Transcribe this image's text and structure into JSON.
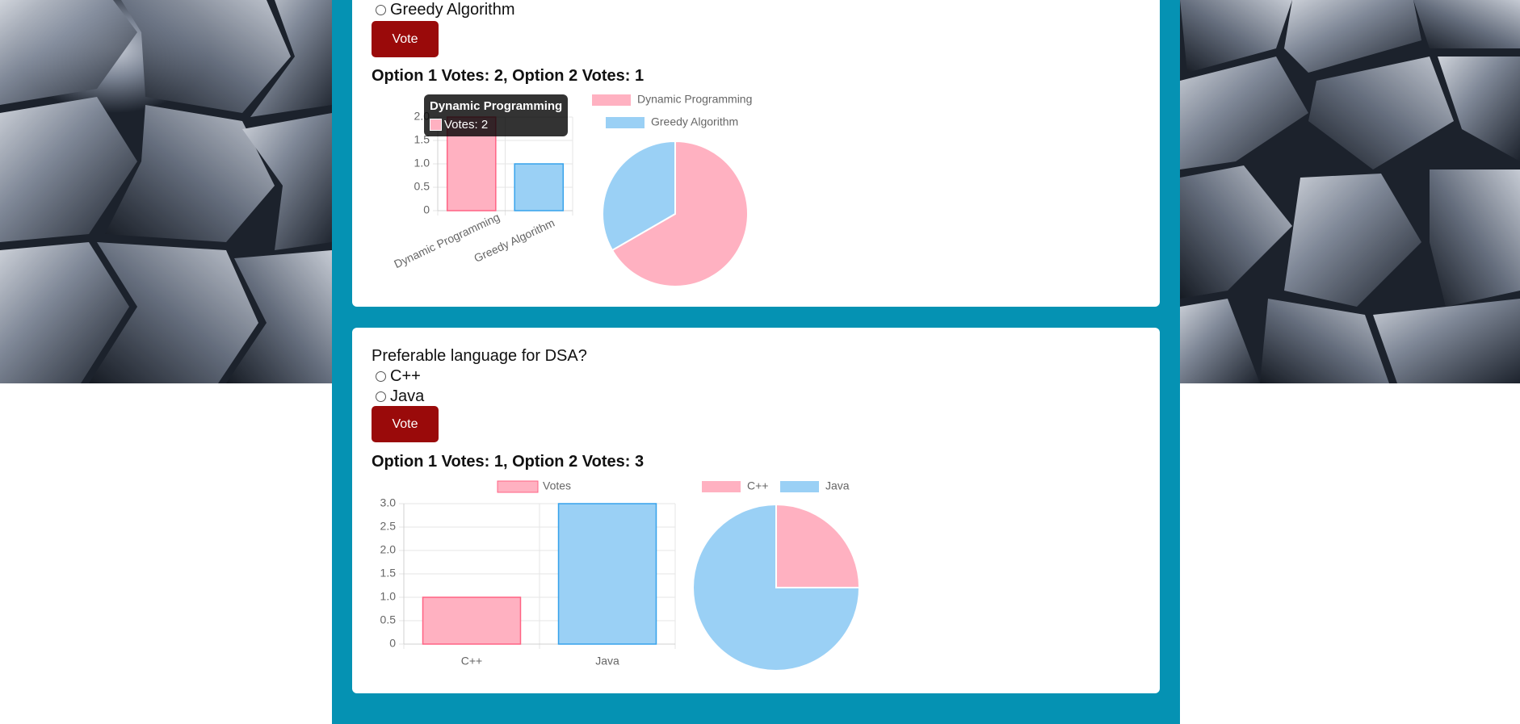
{
  "colors": {
    "column": "#0592b3",
    "vote_button": "#9a0a0a",
    "series_pink_fill": "#ffb1c1",
    "series_pink_stroke": "#ff6384",
    "series_blue_fill": "#9ad0f5",
    "series_blue_stroke": "#36a2eb"
  },
  "poll1": {
    "options": [
      "Greedy Algorithm"
    ],
    "vote_label": "Vote",
    "summary": "Option 1 Votes: 2, Option 2 Votes: 1",
    "tooltip": {
      "title": "Dynamic Programming",
      "body": "Votes: 2"
    }
  },
  "poll2": {
    "question": "Preferable language for DSA?",
    "options": [
      "C++",
      "Java"
    ],
    "vote_label": "Vote",
    "summary": "Option 1 Votes: 1, Option 2 Votes: 3"
  },
  "chart_data": [
    {
      "type": "bar",
      "legend": [
        "Votes"
      ],
      "categories": [
        "Dynamic Programming",
        "Greedy Algorithm"
      ],
      "values": [
        2,
        1
      ],
      "ylim": [
        0,
        2
      ],
      "yticks": [
        "0",
        "0.5",
        "1.0",
        "1.5",
        "2.0"
      ]
    },
    {
      "type": "pie",
      "labels": [
        "Dynamic Programming",
        "Greedy Algorithm"
      ],
      "values": [
        2,
        1
      ],
      "legend_position": "top"
    },
    {
      "type": "bar",
      "legend": [
        "Votes"
      ],
      "categories": [
        "C++",
        "Java"
      ],
      "values": [
        1,
        3
      ],
      "ylim": [
        0,
        3
      ],
      "yticks": [
        "0",
        "0.5",
        "1.0",
        "1.5",
        "2.0",
        "2.5",
        "3.0"
      ]
    },
    {
      "type": "pie",
      "labels": [
        "C++",
        "Java"
      ],
      "values": [
        1,
        3
      ],
      "legend_position": "top"
    }
  ]
}
